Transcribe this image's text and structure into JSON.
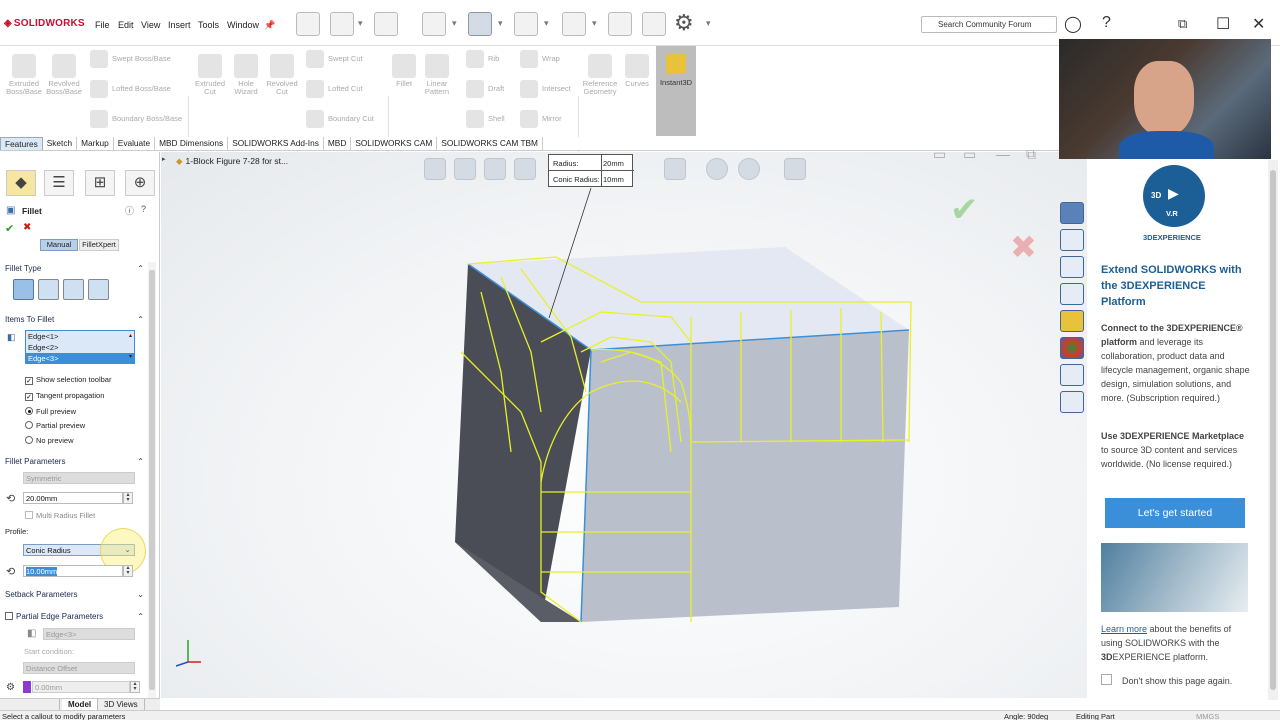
{
  "app": {
    "name": "SOLIDWORKS"
  },
  "menu": [
    "File",
    "Edit",
    "View",
    "Insert",
    "Tools",
    "Window"
  ],
  "search": {
    "placeholder": "Search Community Forum"
  },
  "commands": {
    "extruded_boss": "Extruded Boss/Base",
    "revolved_boss": "Revolved Boss/Base",
    "swept_boss": "Swept Boss/Base",
    "lofted_boss": "Lofted Boss/Base",
    "boundary_boss": "Boundary Boss/Base",
    "extruded_cut": "Extruded Cut",
    "hole_wizard": "Hole Wizard",
    "revolved_cut": "Revolved Cut",
    "swept_cut": "Swept Cut",
    "lofted_cut": "Lofted Cut",
    "boundary_cut": "Boundary Cut",
    "fillet": "Fillet",
    "linear_pattern": "Linear Pattern",
    "rib": "Rib",
    "draft": "Draft",
    "shell": "Shell",
    "wrap": "Wrap",
    "intersect": "Intersect",
    "mirror": "Mirror",
    "reference_geometry": "Reference Geometry",
    "curves": "Curves",
    "instant3d": "Instant3D"
  },
  "tabs": [
    "Features",
    "Sketch",
    "Markup",
    "Evaluate",
    "MBD Dimensions",
    "SOLIDWORKS Add-Ins",
    "MBD",
    "SOLIDWORKS CAM",
    "SOLIDWORKS CAM TBM"
  ],
  "tree": {
    "item": "1-Block Figure 7-28 for st..."
  },
  "pm": {
    "title": "Fillet",
    "mode_manual": "Manual",
    "mode_filletxpert": "FilletXpert",
    "fillet_type_heading": "Fillet Type",
    "items_heading": "Items To Fillet",
    "edges": [
      "Edge<1>",
      "Edge<2>",
      "Edge<3>"
    ],
    "show_toolbar": "Show selection toolbar",
    "tangent": "Tangent propagation",
    "full_preview": "Full preview",
    "partial_preview": "Partial preview",
    "no_preview": "No preview",
    "params_heading": "Fillet Parameters",
    "symmetric": "Symmetric",
    "radius": "20.00mm",
    "multi_radius": "Multi Radius Fillet",
    "profile_label": "Profile:",
    "profile": "Conic Radius",
    "conic": "10.00mm",
    "setback_heading": "Setback Parameters",
    "partial_heading": "Partial Edge Parameters",
    "partial_edge": "Edge<3>",
    "start_condition": "Start condition:",
    "distance_offset": "Distance Offset",
    "offset_value": "0.00mm"
  },
  "callout": {
    "radius_label": "Radius:",
    "radius_value": "20mm",
    "conic_label": "Conic Radius:",
    "conic_value": "10mm"
  },
  "taskpane": {
    "logo_top": "3D",
    "logo_mid": "V.R",
    "logo_brand": "3DEXPERIENCE",
    "heading": "Extend SOLIDWORKS with the 3DEXPERIENCE Platform",
    "p1_bold": "Connect to the 3DEXPERIENCE® platform",
    "p1_rest": " and leverage its collaboration, product data and lifecycle management, organic shape design, simulation solutions, and more. (Subscription required.)",
    "p2_bold": "Use 3DEXPERIENCE Marketplace",
    "p2_rest": " to source 3D content and services worldwide. (No license required.)",
    "button": "Let's get started",
    "learn_link": "Learn more",
    "learn_rest1": " about the benefits of using SOLIDWORKS with the ",
    "learn_bold": "3D",
    "learn_rest2": "EXPERIENCE platform.",
    "dont_show": "Don't show this page again."
  },
  "bottom_tabs": [
    "Model",
    "3D Views"
  ],
  "status": {
    "left": "Select a callout to modify parameters",
    "angle": "Angle: 90deg",
    "mode": "Editing Part",
    "units": "MMGS"
  },
  "colors": {
    "accent": "#3b8fd9",
    "fillet_preview": "#e8f02a",
    "dark_face": "#4a4d55",
    "light_face": "#b9c0cc"
  }
}
